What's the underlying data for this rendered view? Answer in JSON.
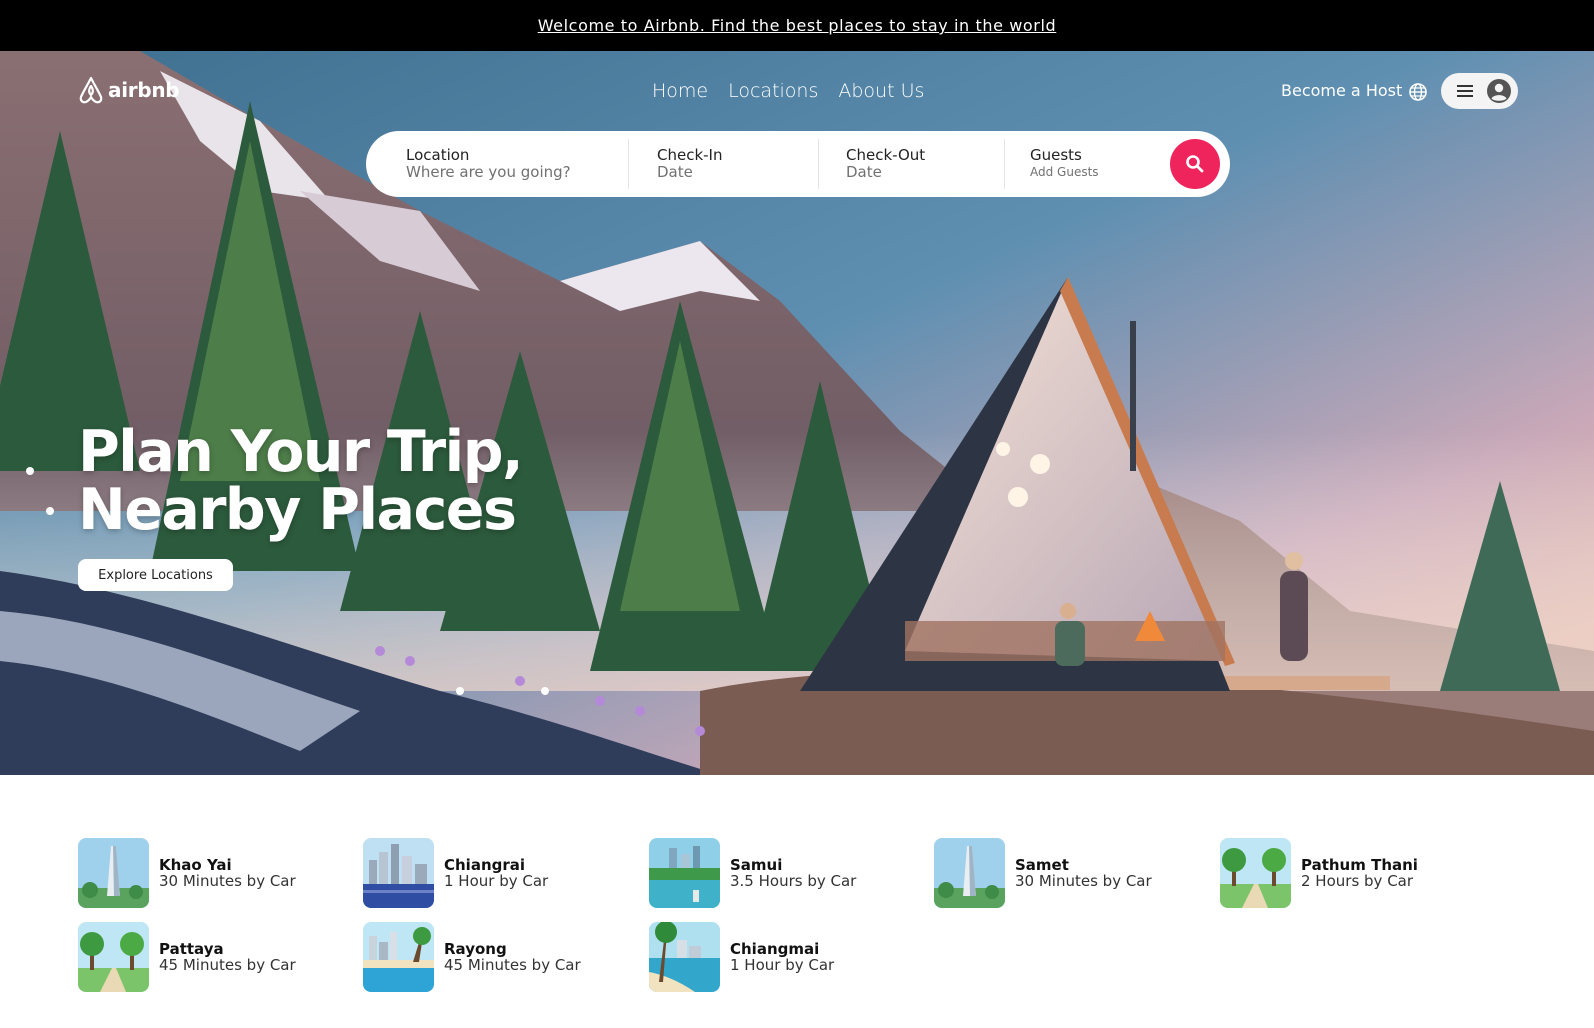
{
  "announcement": "Welcome to Airbnb. Find the best places to stay in the world",
  "brand": {
    "name": "airbnb",
    "accent": "#f0245c"
  },
  "nav": {
    "links": [
      "Home",
      "Locations",
      "About Us"
    ]
  },
  "header": {
    "host_label": "Become a Host",
    "globe_icon": "globe-icon",
    "menu_icon": "hamburger-icon",
    "avatar_icon": "user-circle-icon"
  },
  "search": {
    "location": {
      "label": "Location",
      "placeholder": "Where are you going?"
    },
    "checkin": {
      "label": "Check-In",
      "placeholder": "Date"
    },
    "checkout": {
      "label": "Check-Out",
      "placeholder": "Date"
    },
    "guests": {
      "label": "Guests",
      "placeholder": "Add Guests"
    },
    "button_icon": "search-icon"
  },
  "hero": {
    "line1": "Plan Your Trip,",
    "line2": "Nearby Places",
    "cta": "Explore Locations"
  },
  "places": [
    {
      "name": "Khao Yai",
      "time": "30 Minutes by Car",
      "thumb": "tower"
    },
    {
      "name": "Chiangrai",
      "time": "1 Hour by Car",
      "thumb": "skyline"
    },
    {
      "name": "Samui",
      "time": "3.5 Hours by Car",
      "thumb": "river-city"
    },
    {
      "name": "Samet",
      "time": "30 Minutes by Car",
      "thumb": "tower"
    },
    {
      "name": "Pathum Thani",
      "time": "2 Hours by Car",
      "thumb": "park"
    },
    {
      "name": "Pattaya",
      "time": "45 Minutes by Car",
      "thumb": "park"
    },
    {
      "name": "Rayong",
      "time": "45 Minutes by Car",
      "thumb": "beach-city"
    },
    {
      "name": "Chiangmai",
      "time": "1 Hour by Car",
      "thumb": "palm-beach"
    }
  ]
}
